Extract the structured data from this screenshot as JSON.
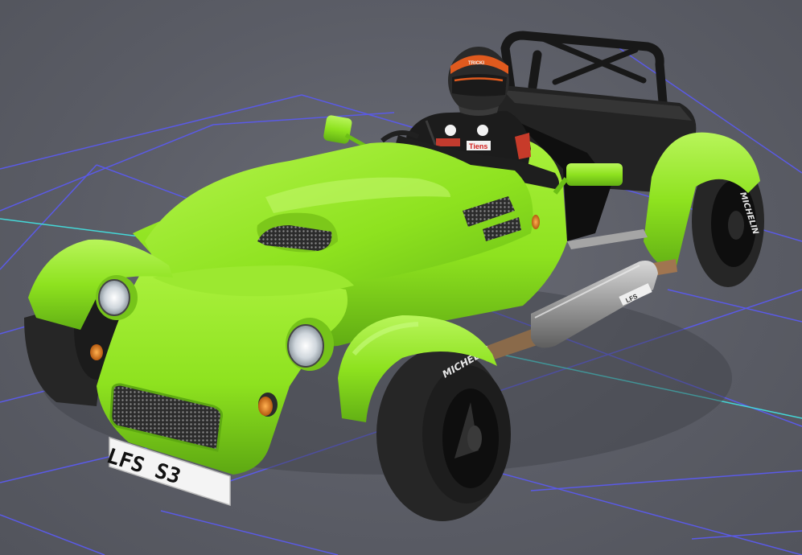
{
  "scene": {
    "background_color": "#5b5d66",
    "grid_color": "#5a5ae6",
    "axis_color": "#44d8d8"
  },
  "car": {
    "body_color": "#8ee21f",
    "body_shadow_color": "#5da812",
    "roll_cage_color": "#181818",
    "tyre_color": "#262626",
    "rim_color": "#0e0e0e",
    "license_plate": "LFS S3",
    "tyre_brand": "MICHELIN",
    "exhaust_label": "LFS"
  },
  "driver": {
    "helmet_color": "#2a2a2a",
    "helmet_stripe_color": "#e05a1e",
    "suit_color": "#1c1c1c",
    "helmet_text": "TRICKI",
    "suit_sponsor_1": "Tiens"
  }
}
